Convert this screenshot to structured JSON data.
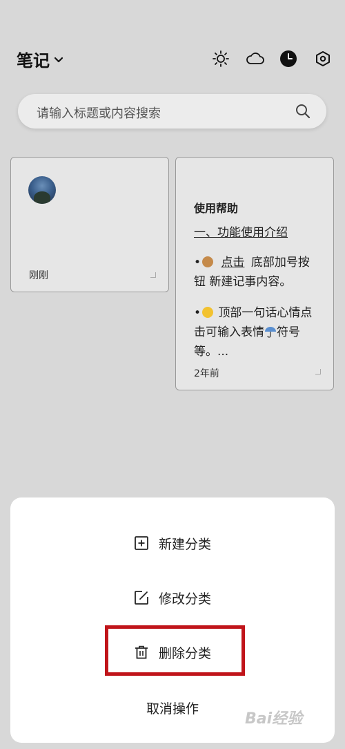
{
  "header": {
    "title": "笔记",
    "icons": [
      "chevron-down-icon",
      "sun-icon",
      "cloud-icon",
      "clock-icon",
      "settings-icon"
    ]
  },
  "search": {
    "placeholder": "请输入标题或内容搜索"
  },
  "notes": [
    {
      "time": "刚刚"
    },
    {
      "title": "使用帮助",
      "subtitle": "一、功能使用介绍",
      "line1_link": "点击",
      "line1_rest": "底部加号按钮 新建记事内容。",
      "line2_a": "顶部一句话心情点击可输入表情",
      "line2_b": "符号等。...",
      "time": "2年前"
    }
  ],
  "sheet": {
    "items": [
      {
        "label": "新建分类",
        "icon": "plus-square-icon"
      },
      {
        "label": "修改分类",
        "icon": "edit-icon"
      },
      {
        "label": "删除分类",
        "icon": "trash-icon"
      },
      {
        "label": "取消操作"
      }
    ],
    "highlight_color": "#c0141a"
  },
  "watermark": "Bai经验"
}
